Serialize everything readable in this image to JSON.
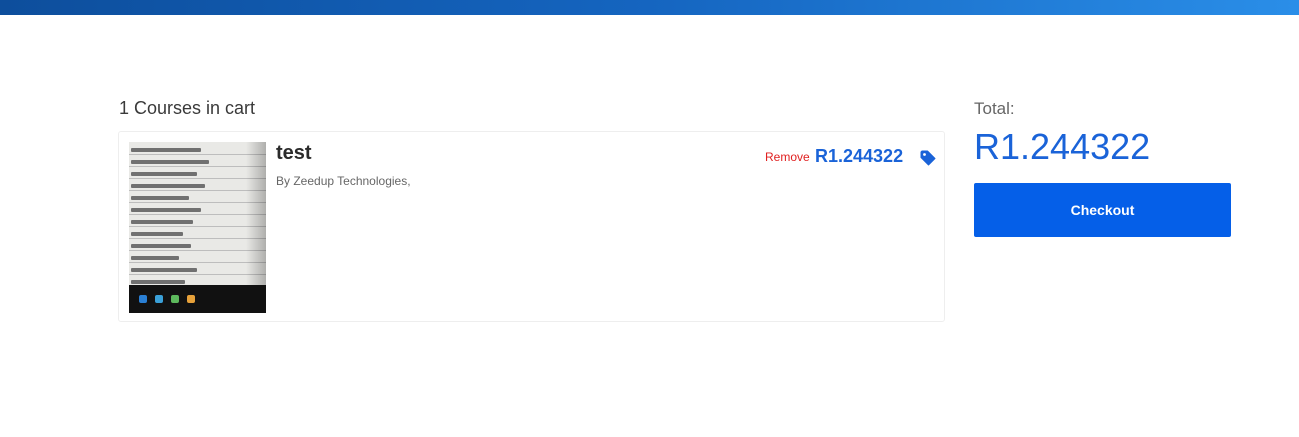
{
  "cart": {
    "count_text": "1 Courses in cart",
    "items": [
      {
        "title": "test",
        "author": "By Zeedup Technologies,",
        "remove_label": "Remove",
        "price": "R1.244322",
        "price_icon": "tag-icon",
        "thumbnail_icon": "course-thumbnail"
      }
    ]
  },
  "summary": {
    "total_label": "Total:",
    "total_value": "R1.244322",
    "checkout_label": "Checkout"
  },
  "colors": {
    "accent": "#1a63d8",
    "button": "#055fe8",
    "remove": "#e02020",
    "topbar_start": "#0d4e9c",
    "topbar_end": "#2a8ee8"
  }
}
